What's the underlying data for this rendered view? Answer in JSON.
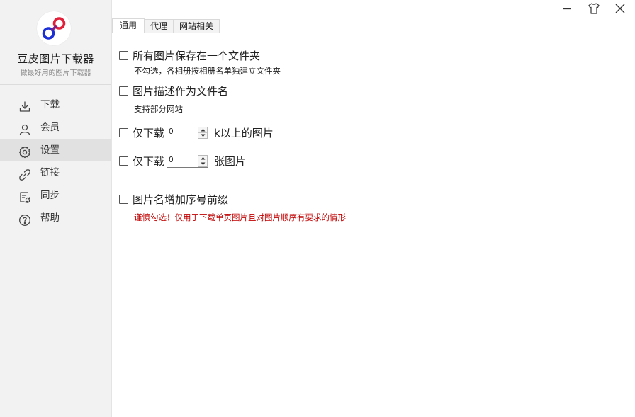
{
  "app": {
    "title": "豆皮图片下载器",
    "subtitle": "做最好用的图片下载器"
  },
  "sidebar": {
    "items": [
      {
        "label": "下载",
        "icon": "download-icon"
      },
      {
        "label": "会员",
        "icon": "user-icon"
      },
      {
        "label": "设置",
        "icon": "gear-icon",
        "active": true
      },
      {
        "label": "链接",
        "icon": "link-icon"
      },
      {
        "label": "同步",
        "icon": "sync-icon"
      },
      {
        "label": "帮助",
        "icon": "help-icon"
      }
    ]
  },
  "window": {
    "controls": [
      "minimize-icon",
      "skin-icon",
      "close-icon"
    ]
  },
  "tabs": [
    {
      "label": "通用",
      "active": true
    },
    {
      "label": "代理"
    },
    {
      "label": "网站相关"
    }
  ],
  "options": {
    "same_folder": {
      "label": "所有图片保存在一个文件夹",
      "hint": "不勾选，各相册按相册名单独建立文件夹",
      "checked": false
    },
    "desc_filename": {
      "label": "图片描述作为文件名",
      "hint": "支持部分网站",
      "checked": false
    },
    "min_size": {
      "prefix": "仅下载",
      "value": "0",
      "suffix": "k以上的图片",
      "checked": false
    },
    "max_count": {
      "prefix": "仅下载",
      "value": "0",
      "suffix": "张图片",
      "checked": false
    },
    "seq_prefix": {
      "label": "图片名增加序号前缀",
      "hint": "谨慎勾选！仅用于下载单页图片且对图片顺序有要求的情形",
      "checked": false
    }
  },
  "colors": {
    "warning_text": "#c00000",
    "sidebar_bg": "#f2f2f2",
    "active_item_bg": "#e1e1e1",
    "logo_blue": "#1b2fd6",
    "logo_red": "#e2203a"
  }
}
